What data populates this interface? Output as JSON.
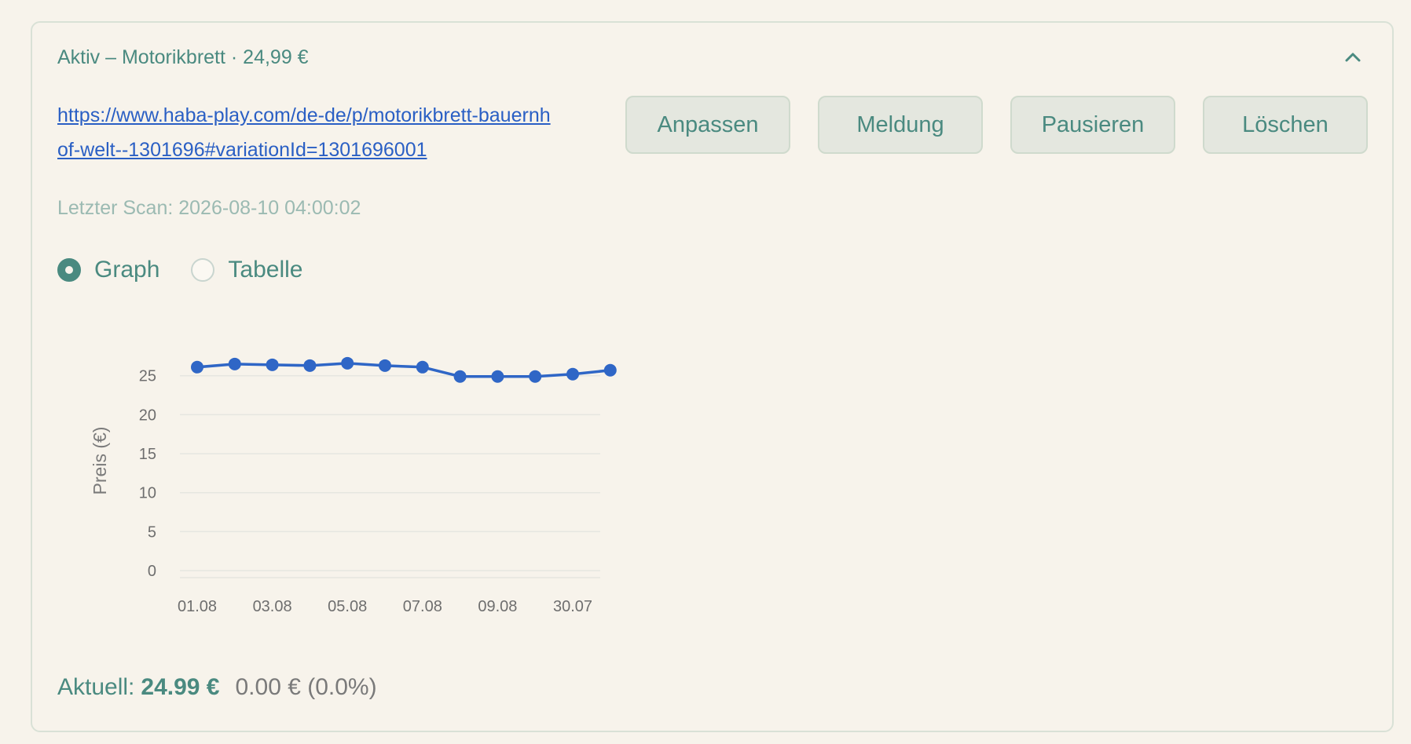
{
  "card": {
    "title": "Aktiv – Motorikbrett · 24,99 €",
    "collapse_icon": "chevron-up-icon",
    "url": "https://www.haba-play.com/de-de/p/motorikbrett-bauernhof-welt--1301696#variationId=1301696001",
    "buttons": {
      "adjust": "Anpassen",
      "report": "Meldung",
      "pause": "Pausieren",
      "delete": "Löschen"
    },
    "last_scan": "Letzter Scan: 2026-08-10 04:00:02",
    "view_options": {
      "graph": "Graph",
      "table": "Tabelle",
      "selected": "graph"
    },
    "current": {
      "label": "Aktuell:",
      "value": "24.99 €",
      "delta": "0.00 € (0.0%)"
    }
  },
  "colors": {
    "accent": "#4a8a80",
    "line": "#2f66c6",
    "link": "#2a5fc4",
    "background": "#f7f3eb"
  },
  "chart_data": {
    "type": "line",
    "ylabel": "Preis (€)",
    "yticks": [
      0,
      5,
      10,
      15,
      20,
      25
    ],
    "ylim": [
      -1,
      29
    ],
    "x_tick_labels": [
      "01.08",
      "03.08",
      "05.08",
      "07.08",
      "09.08",
      "30.07"
    ],
    "x_tick_indices": [
      0,
      2,
      4,
      6,
      8,
      10
    ],
    "grid": true,
    "series": [
      {
        "values": [
          26.1,
          26.5,
          26.4,
          26.3,
          26.6,
          26.3,
          26.1,
          24.9,
          24.9,
          24.9,
          25.2,
          25.7
        ]
      }
    ]
  }
}
